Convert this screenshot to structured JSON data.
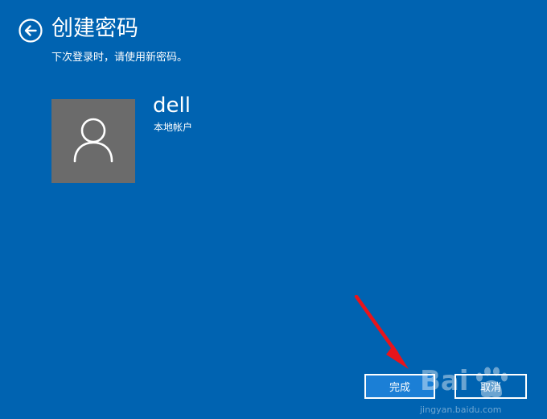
{
  "page": {
    "title": "创建密码",
    "subtitle": "下次登录时，请使用新密码。",
    "back_icon": "arrow-left-circle-icon"
  },
  "account": {
    "name": "dell",
    "type": "本地帐户",
    "avatar_icon": "user-icon"
  },
  "buttons": {
    "finish": "完成",
    "cancel": "取消"
  },
  "annotation": {
    "arrow_color": "#e8141b",
    "arrow_icon": "red-arrow-annotation"
  },
  "watermark": {
    "url": "jingyan.baidu.com",
    "logo": "baidu-paw-icon"
  },
  "colors": {
    "background": "#0063b1",
    "avatar_background": "#6b6b6b",
    "finish_button": "#1b7fd6",
    "text": "#ffffff"
  }
}
